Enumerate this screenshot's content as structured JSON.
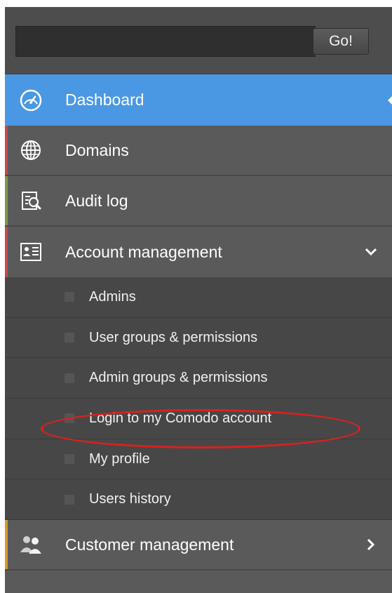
{
  "search": {
    "value": "",
    "go_label": "Go!"
  },
  "nav": {
    "dashboard": {
      "label": "Dashboard",
      "icon": "dashboard-gauge-icon"
    },
    "domains": {
      "label": "Domains",
      "icon": "globe-icon"
    },
    "audit_log": {
      "label": "Audit log",
      "icon": "audit-log-icon"
    },
    "account_management": {
      "label": "Account management",
      "icon": "account-card-icon",
      "expanded": true,
      "subitems": [
        {
          "label": "Admins"
        },
        {
          "label": "User groups & permissions"
        },
        {
          "label": "Admin groups & permissions"
        },
        {
          "label": "Login to my Comodo account"
        },
        {
          "label": "My profile"
        },
        {
          "label": "Users history"
        }
      ]
    },
    "customer_management": {
      "label": "Customer management",
      "icon": "customers-icon"
    }
  },
  "colors": {
    "active": "#4a98e3",
    "domains_accent": "#c44a4a",
    "audit_accent": "#7a9a4a",
    "account_accent": "#c44a4a",
    "customer_accent": "#d49a2a",
    "annotation": "#d9211f"
  }
}
